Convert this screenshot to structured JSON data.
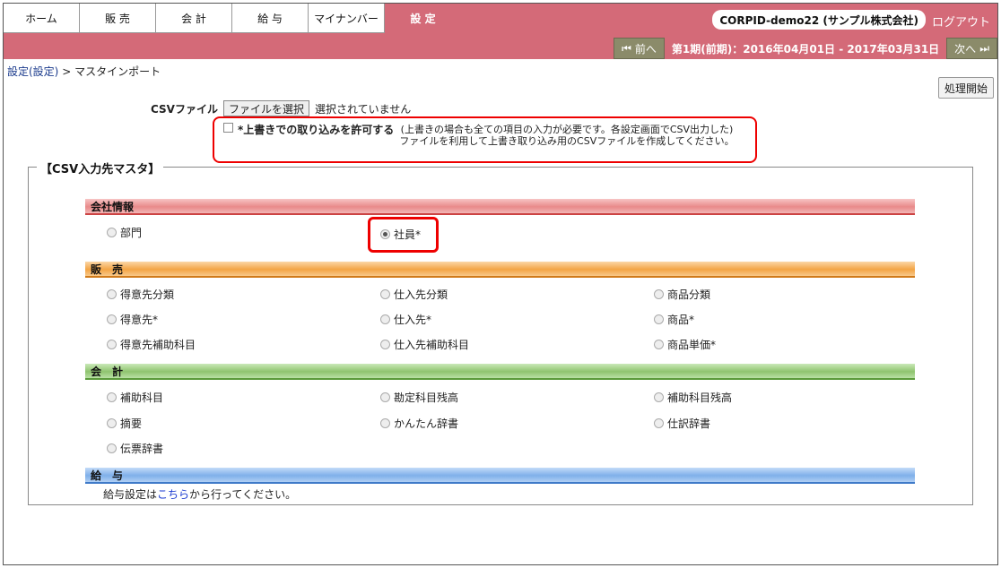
{
  "nav": {
    "tabs": [
      "ホーム",
      "販 売",
      "会 計",
      "給 与",
      "マイナンバー",
      "設 定"
    ],
    "corp": "CORPID-demo22 (サンプル株式会社)",
    "logout": "ログアウト",
    "prev": "前へ",
    "next": "次へ",
    "period": "第1期(前期)：2016年04月01日 - 2017年03月31日"
  },
  "breadcrumb": {
    "link": "設定(設定)",
    "sep": " > ",
    "current": "マスタインポート"
  },
  "start_button": "処理開始",
  "csv": {
    "label": "CSVファイル",
    "button": "ファイルを選択",
    "status": "選択されていません"
  },
  "overwrite": {
    "label": "*上書きでの取り込みを許可する",
    "note_line1": "(上書きの場合も全ての項目の入力が必要です。各設定画面でCSV出力した)",
    "note_line2": "ファイルを利用して上書き取り込み用のCSVファイルを作成してください。"
  },
  "legend": "【CSV入力先マスタ】",
  "sections": {
    "company": {
      "title": "会社情報",
      "items": [
        "部門",
        "社員*"
      ]
    },
    "sales": {
      "title": "販　売",
      "items": [
        "得意先分類",
        "仕入先分類",
        "商品分類",
        "得意先*",
        "仕入先*",
        "商品*",
        "得意先補助科目",
        "仕入先補助科目",
        "商品単価*"
      ]
    },
    "accounting": {
      "title": "会　計",
      "items": [
        "補助科目",
        "勘定科目残高",
        "補助科目残高",
        "摘要",
        "かんたん辞書",
        "仕訳辞書",
        "伝票辞書"
      ]
    },
    "payroll": {
      "title": "給　与",
      "note_pre": "給与設定は",
      "note_link": "こちら",
      "note_post": "から行ってください。"
    }
  },
  "selected": "社員*"
}
